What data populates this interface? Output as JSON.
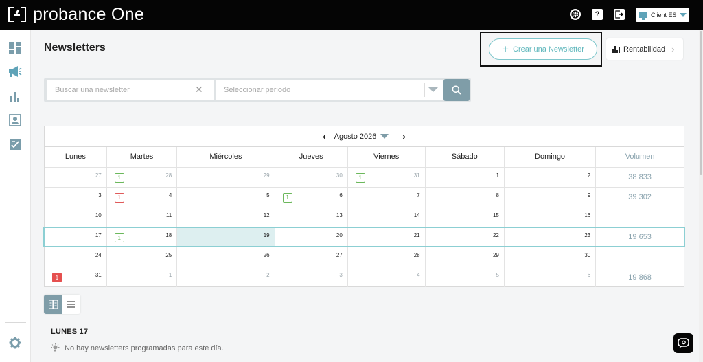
{
  "brand": {
    "name": "probance One"
  },
  "topbar": {
    "client_label": "Client ES",
    "help_label": "?"
  },
  "page": {
    "title": "Newsletters"
  },
  "actions": {
    "create_label": "Crear una Newsletter",
    "rentabilidad_label": "Rentabilidad"
  },
  "search": {
    "placeholder": "Buscar una newsletter",
    "period_placeholder": "Seleccionar periodo"
  },
  "calendar": {
    "month_label": "Agosto 2026",
    "weekdays": [
      "Lunes",
      "Martes",
      "Miércoles",
      "Jueves",
      "Viernes",
      "Sábado",
      "Domingo"
    ],
    "volume_header": "Volumen",
    "weeks": [
      {
        "days": [
          {
            "num": "27",
            "muted": true,
            "badge": null
          },
          {
            "num": "28",
            "muted": true,
            "badge": {
              "count": "1",
              "style": "green"
            }
          },
          {
            "num": "29",
            "muted": true,
            "badge": null
          },
          {
            "num": "30",
            "muted": true,
            "badge": null
          },
          {
            "num": "31",
            "muted": true,
            "badge": {
              "count": "1",
              "style": "green"
            }
          },
          {
            "num": "1",
            "muted": false,
            "badge": null
          },
          {
            "num": "2",
            "muted": false,
            "badge": null
          }
        ],
        "volume": "38 833"
      },
      {
        "days": [
          {
            "num": "3",
            "muted": false,
            "badge": null
          },
          {
            "num": "4",
            "muted": false,
            "badge": {
              "count": "1",
              "style": "red"
            }
          },
          {
            "num": "5",
            "muted": false,
            "badge": null
          },
          {
            "num": "6",
            "muted": false,
            "badge": {
              "count": "1",
              "style": "green"
            }
          },
          {
            "num": "7",
            "muted": false,
            "badge": null
          },
          {
            "num": "8",
            "muted": false,
            "badge": null
          },
          {
            "num": "9",
            "muted": false,
            "badge": null
          }
        ],
        "volume": "39 302"
      },
      {
        "days": [
          {
            "num": "10",
            "muted": false,
            "badge": null
          },
          {
            "num": "11",
            "muted": false,
            "badge": null
          },
          {
            "num": "12",
            "muted": false,
            "badge": null
          },
          {
            "num": "13",
            "muted": false,
            "badge": null
          },
          {
            "num": "14",
            "muted": false,
            "badge": null
          },
          {
            "num": "15",
            "muted": false,
            "badge": null
          },
          {
            "num": "16",
            "muted": false,
            "badge": null
          }
        ],
        "volume": ""
      },
      {
        "days": [
          {
            "num": "17",
            "muted": false,
            "badge": null
          },
          {
            "num": "18",
            "muted": false,
            "badge": {
              "count": "1",
              "style": "green"
            }
          },
          {
            "num": "19",
            "muted": false,
            "badge": null,
            "today": true
          },
          {
            "num": "20",
            "muted": false,
            "badge": null
          },
          {
            "num": "21",
            "muted": false,
            "badge": null
          },
          {
            "num": "22",
            "muted": false,
            "badge": null
          },
          {
            "num": "23",
            "muted": false,
            "badge": null
          }
        ],
        "volume": "19 653",
        "selected": true
      },
      {
        "days": [
          {
            "num": "24",
            "muted": false,
            "badge": null
          },
          {
            "num": "25",
            "muted": false,
            "badge": null
          },
          {
            "num": "26",
            "muted": false,
            "badge": null
          },
          {
            "num": "27",
            "muted": false,
            "badge": null
          },
          {
            "num": "28",
            "muted": false,
            "badge": null
          },
          {
            "num": "29",
            "muted": false,
            "badge": null
          },
          {
            "num": "30",
            "muted": false,
            "badge": null
          }
        ],
        "volume": ""
      },
      {
        "days": [
          {
            "num": "31",
            "muted": false,
            "badge": {
              "count": "1",
              "style": "red-solid"
            }
          },
          {
            "num": "1",
            "muted": true,
            "badge": null
          },
          {
            "num": "2",
            "muted": true,
            "badge": null
          },
          {
            "num": "3",
            "muted": true,
            "badge": null
          },
          {
            "num": "4",
            "muted": true,
            "badge": null
          },
          {
            "num": "5",
            "muted": true,
            "badge": null
          },
          {
            "num": "6",
            "muted": true,
            "badge": null
          }
        ],
        "volume": "19 868"
      }
    ]
  },
  "day_detail": {
    "label": "LUNES 17",
    "empty_message": "No hay newsletters programadas para este día."
  },
  "colors": {
    "accent": "#5fb7bc",
    "slate": "#7f9da8",
    "badge_green": "#6cb85c",
    "badge_red": "#e05a5a",
    "today_bg": "#ddeff0"
  },
  "icons": [
    "globe-icon",
    "help-icon",
    "logout-icon",
    "monitor-icon",
    "dashboard-icon",
    "megaphone-icon",
    "bar-chart-icon",
    "contacts-icon",
    "checklist-icon",
    "settings-icon",
    "search-icon",
    "chat-icon",
    "lightbulb-icon"
  ]
}
